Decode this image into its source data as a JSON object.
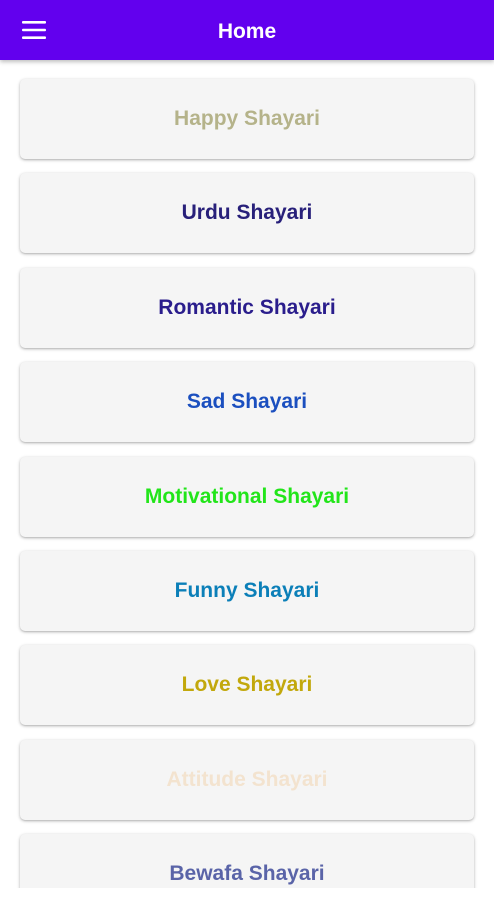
{
  "appbar": {
    "title": "Home",
    "menu_icon": "hamburger-menu-icon",
    "background": "#6200ee"
  },
  "categories": [
    {
      "label": "Happy Shayari",
      "color": "#b5b38a"
    },
    {
      "label": "Urdu Shayari",
      "color": "#28207a"
    },
    {
      "label": "Romantic Shayari",
      "color": "#2a1d8c"
    },
    {
      "label": "Sad Shayari",
      "color": "#1b4fbf"
    },
    {
      "label": "Motivational Shayari",
      "color": "#22e51a"
    },
    {
      "label": "Funny Shayari",
      "color": "#0b7fb8"
    },
    {
      "label": "Love Shayari",
      "color": "#c2a80c"
    },
    {
      "label": "Attitude Shayari",
      "color": "#f3e3cf"
    },
    {
      "label": "Bewafa Shayari",
      "color": "#5a64a8"
    }
  ]
}
